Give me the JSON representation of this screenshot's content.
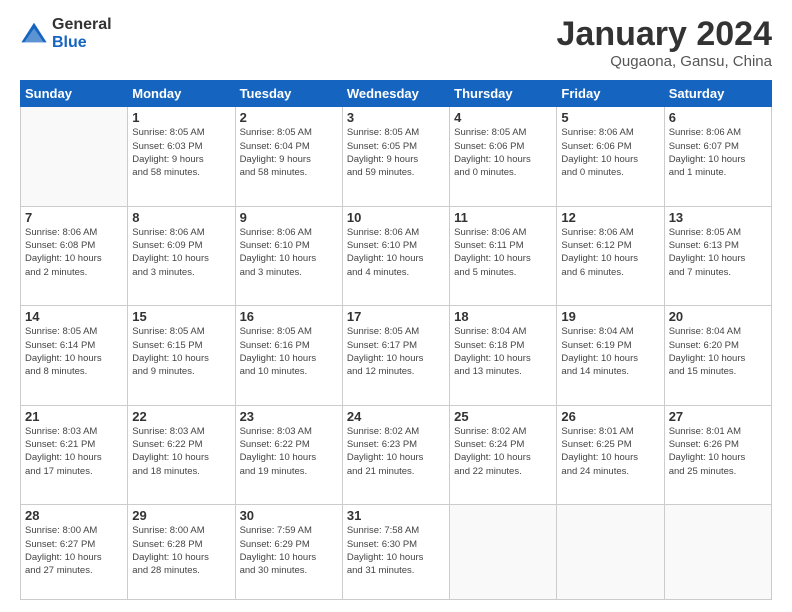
{
  "logo": {
    "text_general": "General",
    "text_blue": "Blue"
  },
  "title": "January 2024",
  "subtitle": "Qugaona, Gansu, China",
  "days_of_week": [
    "Sunday",
    "Monday",
    "Tuesday",
    "Wednesday",
    "Thursday",
    "Friday",
    "Saturday"
  ],
  "weeks": [
    [
      {
        "day": "",
        "info": ""
      },
      {
        "day": "1",
        "info": "Sunrise: 8:05 AM\nSunset: 6:03 PM\nDaylight: 9 hours\nand 58 minutes."
      },
      {
        "day": "2",
        "info": "Sunrise: 8:05 AM\nSunset: 6:04 PM\nDaylight: 9 hours\nand 58 minutes."
      },
      {
        "day": "3",
        "info": "Sunrise: 8:05 AM\nSunset: 6:05 PM\nDaylight: 9 hours\nand 59 minutes."
      },
      {
        "day": "4",
        "info": "Sunrise: 8:05 AM\nSunset: 6:06 PM\nDaylight: 10 hours\nand 0 minutes."
      },
      {
        "day": "5",
        "info": "Sunrise: 8:06 AM\nSunset: 6:06 PM\nDaylight: 10 hours\nand 0 minutes."
      },
      {
        "day": "6",
        "info": "Sunrise: 8:06 AM\nSunset: 6:07 PM\nDaylight: 10 hours\nand 1 minute."
      }
    ],
    [
      {
        "day": "7",
        "info": "Sunrise: 8:06 AM\nSunset: 6:08 PM\nDaylight: 10 hours\nand 2 minutes."
      },
      {
        "day": "8",
        "info": "Sunrise: 8:06 AM\nSunset: 6:09 PM\nDaylight: 10 hours\nand 3 minutes."
      },
      {
        "day": "9",
        "info": "Sunrise: 8:06 AM\nSunset: 6:10 PM\nDaylight: 10 hours\nand 3 minutes."
      },
      {
        "day": "10",
        "info": "Sunrise: 8:06 AM\nSunset: 6:10 PM\nDaylight: 10 hours\nand 4 minutes."
      },
      {
        "day": "11",
        "info": "Sunrise: 8:06 AM\nSunset: 6:11 PM\nDaylight: 10 hours\nand 5 minutes."
      },
      {
        "day": "12",
        "info": "Sunrise: 8:06 AM\nSunset: 6:12 PM\nDaylight: 10 hours\nand 6 minutes."
      },
      {
        "day": "13",
        "info": "Sunrise: 8:05 AM\nSunset: 6:13 PM\nDaylight: 10 hours\nand 7 minutes."
      }
    ],
    [
      {
        "day": "14",
        "info": "Sunrise: 8:05 AM\nSunset: 6:14 PM\nDaylight: 10 hours\nand 8 minutes."
      },
      {
        "day": "15",
        "info": "Sunrise: 8:05 AM\nSunset: 6:15 PM\nDaylight: 10 hours\nand 9 minutes."
      },
      {
        "day": "16",
        "info": "Sunrise: 8:05 AM\nSunset: 6:16 PM\nDaylight: 10 hours\nand 10 minutes."
      },
      {
        "day": "17",
        "info": "Sunrise: 8:05 AM\nSunset: 6:17 PM\nDaylight: 10 hours\nand 12 minutes."
      },
      {
        "day": "18",
        "info": "Sunrise: 8:04 AM\nSunset: 6:18 PM\nDaylight: 10 hours\nand 13 minutes."
      },
      {
        "day": "19",
        "info": "Sunrise: 8:04 AM\nSunset: 6:19 PM\nDaylight: 10 hours\nand 14 minutes."
      },
      {
        "day": "20",
        "info": "Sunrise: 8:04 AM\nSunset: 6:20 PM\nDaylight: 10 hours\nand 15 minutes."
      }
    ],
    [
      {
        "day": "21",
        "info": "Sunrise: 8:03 AM\nSunset: 6:21 PM\nDaylight: 10 hours\nand 17 minutes."
      },
      {
        "day": "22",
        "info": "Sunrise: 8:03 AM\nSunset: 6:22 PM\nDaylight: 10 hours\nand 18 minutes."
      },
      {
        "day": "23",
        "info": "Sunrise: 8:03 AM\nSunset: 6:22 PM\nDaylight: 10 hours\nand 19 minutes."
      },
      {
        "day": "24",
        "info": "Sunrise: 8:02 AM\nSunset: 6:23 PM\nDaylight: 10 hours\nand 21 minutes."
      },
      {
        "day": "25",
        "info": "Sunrise: 8:02 AM\nSunset: 6:24 PM\nDaylight: 10 hours\nand 22 minutes."
      },
      {
        "day": "26",
        "info": "Sunrise: 8:01 AM\nSunset: 6:25 PM\nDaylight: 10 hours\nand 24 minutes."
      },
      {
        "day": "27",
        "info": "Sunrise: 8:01 AM\nSunset: 6:26 PM\nDaylight: 10 hours\nand 25 minutes."
      }
    ],
    [
      {
        "day": "28",
        "info": "Sunrise: 8:00 AM\nSunset: 6:27 PM\nDaylight: 10 hours\nand 27 minutes."
      },
      {
        "day": "29",
        "info": "Sunrise: 8:00 AM\nSunset: 6:28 PM\nDaylight: 10 hours\nand 28 minutes."
      },
      {
        "day": "30",
        "info": "Sunrise: 7:59 AM\nSunset: 6:29 PM\nDaylight: 10 hours\nand 30 minutes."
      },
      {
        "day": "31",
        "info": "Sunrise: 7:58 AM\nSunset: 6:30 PM\nDaylight: 10 hours\nand 31 minutes."
      },
      {
        "day": "",
        "info": ""
      },
      {
        "day": "",
        "info": ""
      },
      {
        "day": "",
        "info": ""
      }
    ]
  ]
}
